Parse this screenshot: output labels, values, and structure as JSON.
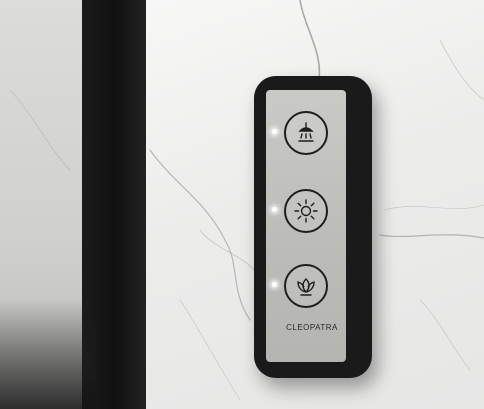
{
  "panel": {
    "brand_name": "CLEOPATRA",
    "brand_tagline": "",
    "buttons": [
      {
        "icon": "shower-head-icon"
      },
      {
        "icon": "sun-icon"
      },
      {
        "icon": "lotus-icon"
      }
    ]
  },
  "colors": {
    "bezel": "#1a1a1a",
    "plate": "#c0c0bd",
    "led": "#ffffff",
    "marble": "#ededec",
    "door_frame": "#141414"
  }
}
